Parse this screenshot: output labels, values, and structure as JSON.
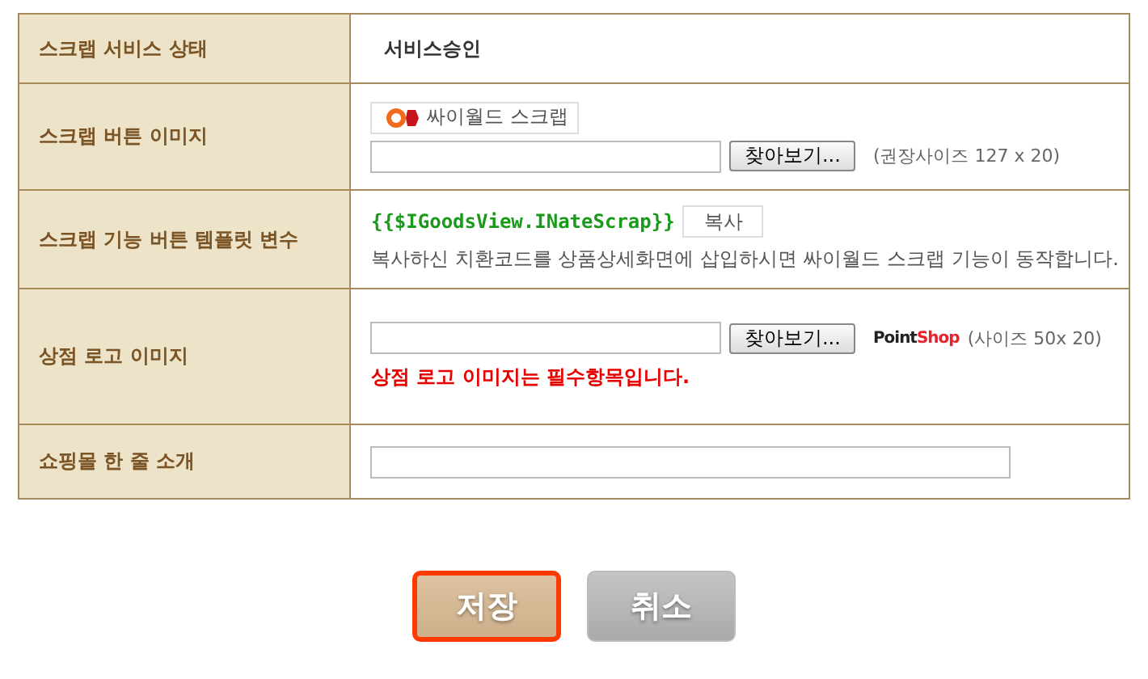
{
  "rows": [
    {
      "kind": "status",
      "label": "스크랩 서비스 상태",
      "value": "서비스승인"
    },
    {
      "kind": "button_image",
      "label": "스크랩 버튼 이미지",
      "scrap_button": "싸이월드 스크랩",
      "browse_button": "찾아보기...",
      "hint": "(권장사이즈 127 x 20)"
    },
    {
      "kind": "template",
      "label": "스크랩 기능 버튼 템플릿 변수",
      "code": "{{$IGoodsView.INateScrap}}",
      "copy_button": "복사",
      "description": "복사하신 치환코드를 상품상세화면에 삽입하시면 싸이월드 스크랩 기능이 동작합니다."
    },
    {
      "kind": "logo",
      "label": "상점 로고 이미지",
      "browse_button": "찾아보기...",
      "logo_left": "Point",
      "logo_right": "Shop",
      "hint": "(사이즈 50x 20)",
      "error": "상점 로고 이미지는 필수항목입니다."
    },
    {
      "kind": "intro",
      "label": "쇼핑몰 한 줄 소개"
    }
  ],
  "buttons": [
    {
      "kind": "save",
      "label": "저장",
      "focused": true
    },
    {
      "kind": "cancel",
      "label": "취소",
      "focused": false
    }
  ]
}
